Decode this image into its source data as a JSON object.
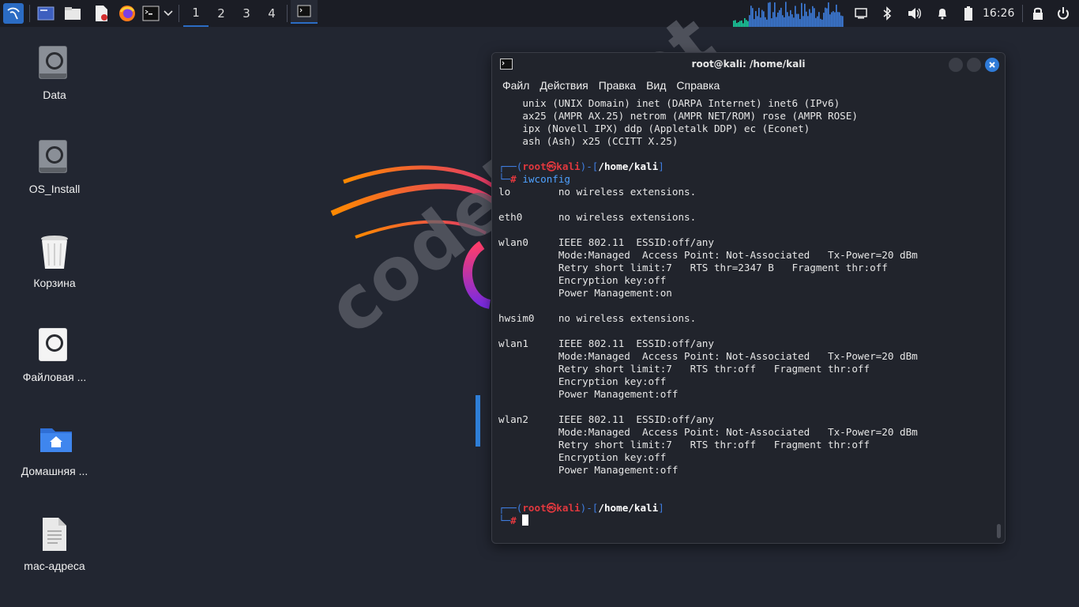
{
  "panel": {
    "workspaces": [
      "1",
      "2",
      "3",
      "4"
    ],
    "active_workspace": "1",
    "clock": "16:26",
    "accent": "#2b6cc4",
    "launchers": [
      "kali-menu-icon",
      "show-desktop-icon",
      "file-manager-icon",
      "text-editor-icon",
      "firefox-icon",
      "terminal-icon",
      "dropdown-chevron-icon"
    ],
    "tray_icons": [
      "display-icon",
      "bluetooth-icon",
      "volume-icon",
      "notifications-bell-icon",
      "battery-icon",
      "lock-icon",
      "power-icon"
    ]
  },
  "desktop_icons": [
    {
      "label": "Data",
      "icon": "drive-icon"
    },
    {
      "label": "OS_Install",
      "icon": "drive-icon"
    },
    {
      "label": "Корзина",
      "icon": "trash-icon"
    },
    {
      "label": "Файловая ...",
      "icon": "filesystem-drive-icon"
    },
    {
      "label": "Домашняя ...",
      "icon": "home-folder-icon"
    },
    {
      "label": "mac-адреса",
      "icon": "text-file-icon"
    }
  ],
  "watermark": "codeby.net",
  "wallpaper_text": "KALI",
  "terminal": {
    "title": "root@kali: /home/kali",
    "menu": [
      "Файл",
      "Действия",
      "Правка",
      "Вид",
      "Справка"
    ],
    "lines_top": [
      "    unix (UNIX Domain) inet (DARPA Internet) inet6 (IPv6)",
      "    ax25 (AMPR AX.25) netrom (AMPR NET/ROM) rose (AMPR ROSE)",
      "    ipx (Novell IPX) ddp (Appletalk DDP) ec (Econet)",
      "    ash (Ash) x25 (CCITT X.25)"
    ],
    "prompt": {
      "user": "root",
      "host": "kali",
      "path": "/home/kali",
      "symbol": "#"
    },
    "command": "iwconfig",
    "output": [
      "lo        no wireless extensions.",
      "",
      "eth0      no wireless extensions.",
      "",
      "wlan0     IEEE 802.11  ESSID:off/any",
      "          Mode:Managed  Access Point: Not-Associated   Tx-Power=20 dBm",
      "          Retry short limit:7   RTS thr=2347 B   Fragment thr:off",
      "          Encryption key:off",
      "          Power Management:on",
      "",
      "hwsim0    no wireless extensions.",
      "",
      "wlan1     IEEE 802.11  ESSID:off/any",
      "          Mode:Managed  Access Point: Not-Associated   Tx-Power=20 dBm",
      "          Retry short limit:7   RTS thr:off   Fragment thr:off",
      "          Encryption key:off",
      "          Power Management:off",
      "",
      "wlan2     IEEE 802.11  ESSID:off/any",
      "          Mode:Managed  Access Point: Not-Associated   Tx-Power=20 dBm",
      "          Retry short limit:7   RTS thr:off   Fragment thr:off",
      "          Encryption key:off",
      "          Power Management:off",
      "",
      ""
    ]
  }
}
